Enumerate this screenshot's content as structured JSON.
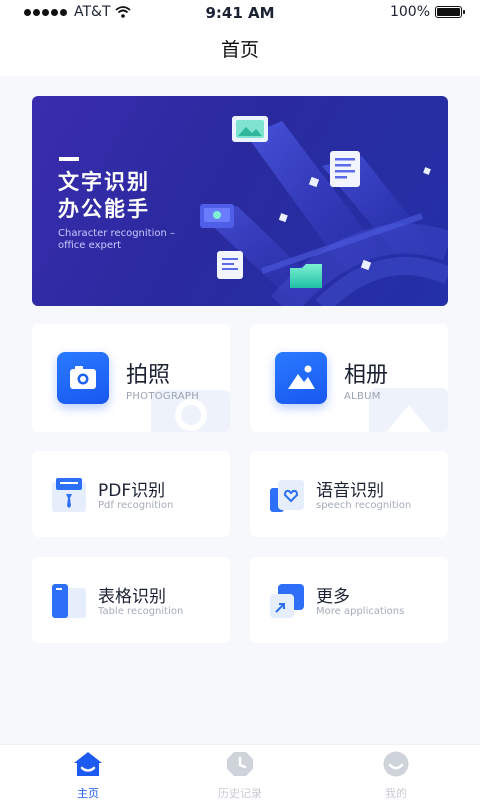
{
  "status": {
    "carrier": "AT&T",
    "time": "9:41 AM",
    "battery": "100%"
  },
  "header": {
    "title": "首页"
  },
  "banner": {
    "headline_line1": "文字识别",
    "headline_line2": "办公能手",
    "subtitle": "Character recognition – office expert"
  },
  "features": {
    "photo": {
      "label": "拍照",
      "sub": "PHOTOGRAPH",
      "icon": "camera-icon"
    },
    "album": {
      "label": "相册",
      "sub": "ALBUM",
      "icon": "image-icon"
    },
    "pdf": {
      "label": "PDF识别",
      "sub": "Pdf recognition",
      "icon": "pdf-doc-icon"
    },
    "speech": {
      "label": "语音识别",
      "sub": "speech recognition",
      "icon": "heart-chat-icon"
    },
    "table": {
      "label": "表格识别",
      "sub": "Table recognition",
      "icon": "table-doc-icon"
    },
    "more": {
      "label": "更多",
      "sub": "More applications",
      "icon": "expand-arrow-icon"
    }
  },
  "tabbar": {
    "items": [
      {
        "label": "主页",
        "icon": "home-icon",
        "active": true
      },
      {
        "label": "历史记录",
        "icon": "clock-icon",
        "active": false
      },
      {
        "label": "我的",
        "icon": "profile-icon",
        "active": false
      }
    ]
  },
  "colors": {
    "accent": "#1d5bf0",
    "banner": "#2a2a9e",
    "background": "#f6f8fb"
  }
}
